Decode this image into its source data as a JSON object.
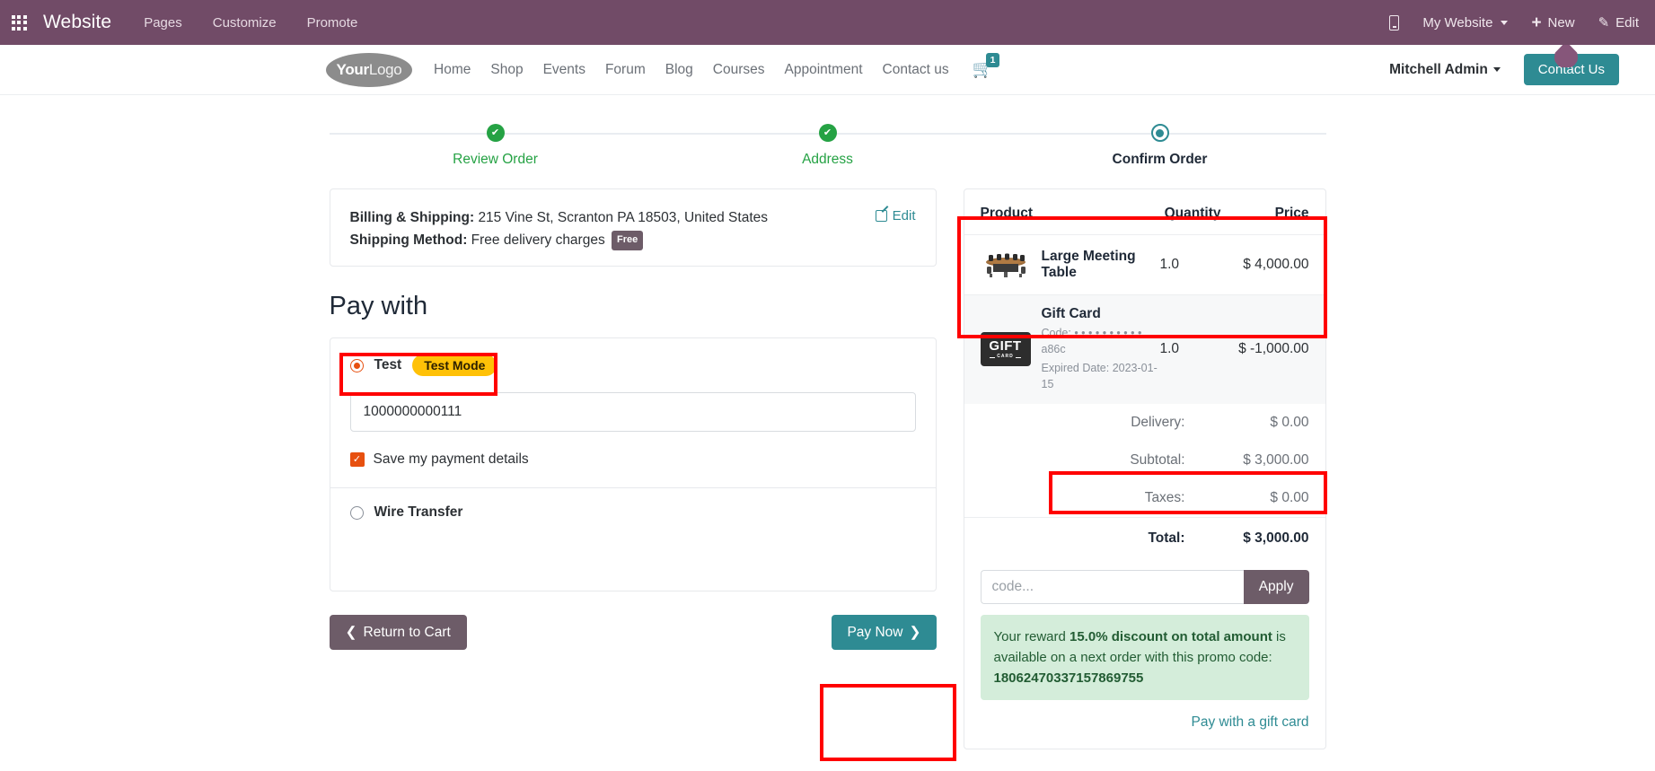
{
  "odoo_bar": {
    "apps_icon": "grid-apps-icon",
    "brand": "Website",
    "menu": [
      "Pages",
      "Customize",
      "Promote"
    ],
    "mobile_preview_icon": "mobile-preview-icon",
    "website_selector": "My Website",
    "new_label": "New",
    "edit_label": "Edit"
  },
  "site_header": {
    "logo_your": "Your",
    "logo_logo": "Logo",
    "nav": [
      "Home",
      "Shop",
      "Events",
      "Forum",
      "Blog",
      "Courses",
      "Appointment",
      "Contact us"
    ],
    "cart_count": "1",
    "user": "Mitchell Admin",
    "contact_button": "Contact Us"
  },
  "wizard": {
    "steps": [
      {
        "label": "Review Order",
        "state": "done"
      },
      {
        "label": "Address",
        "state": "done"
      },
      {
        "label": "Confirm Order",
        "state": "current"
      }
    ]
  },
  "address": {
    "billing_label": "Billing & Shipping:",
    "billing_value": "215 Vine St, Scranton PA 18503, United States",
    "shipping_label": "Shipping Method:",
    "shipping_value": "Free delivery charges",
    "shipping_badge": "Free",
    "edit_label": "Edit"
  },
  "payment": {
    "title": "Pay with",
    "methods": [
      {
        "name": "Test",
        "badge": "Test Mode",
        "selected": true,
        "card_number": "1000000000111",
        "save_details_label": "Save my payment details",
        "save_details_checked": true
      },
      {
        "name": "Wire Transfer",
        "selected": false
      }
    ]
  },
  "actions": {
    "return_to_cart": "Return to Cart",
    "pay_now": "Pay Now"
  },
  "order_summary": {
    "columns": {
      "product": "Product",
      "quantity": "Quantity",
      "price": "Price"
    },
    "lines": [
      {
        "thumb": "meeting-table-photo",
        "name": "Large Meeting Table",
        "sub1": "",
        "sub2": "",
        "quantity": "1.0",
        "price": "$ 4,000.00"
      },
      {
        "thumb": "gift-card-image",
        "name": "Gift Card",
        "sub1": "Code: • • • • • • • • • • a86c",
        "sub2": "Expired Date: 2023-01-15",
        "quantity": "1.0",
        "price": "$ -1,000.00"
      }
    ],
    "totals": [
      {
        "label": "Delivery:",
        "value": "$ 0.00"
      },
      {
        "label": "Subtotal:",
        "value": "$ 3,000.00"
      },
      {
        "label": "Taxes:",
        "value": "$ 0.00"
      }
    ],
    "grand_total": {
      "label": "Total:",
      "value": "$ 3,000.00"
    },
    "promo": {
      "placeholder": "code...",
      "value": "",
      "apply_label": "Apply"
    },
    "reward": {
      "prefix": "Your reward ",
      "highlight": "15.0% discount on total amount",
      "middle": " is available on a next order with this promo code:",
      "code": "18062470337157869755"
    },
    "gift_card_link": "Pay with a gift card"
  },
  "colors": {
    "odoo_purple": "#714B67",
    "teal": "#2E8B93",
    "green_done": "#25A244",
    "annotation_red": "#FF0000",
    "orange_radio": "#e7500f",
    "test_badge_yellow": "#FFC107",
    "reward_green_bg": "#d4edda"
  }
}
